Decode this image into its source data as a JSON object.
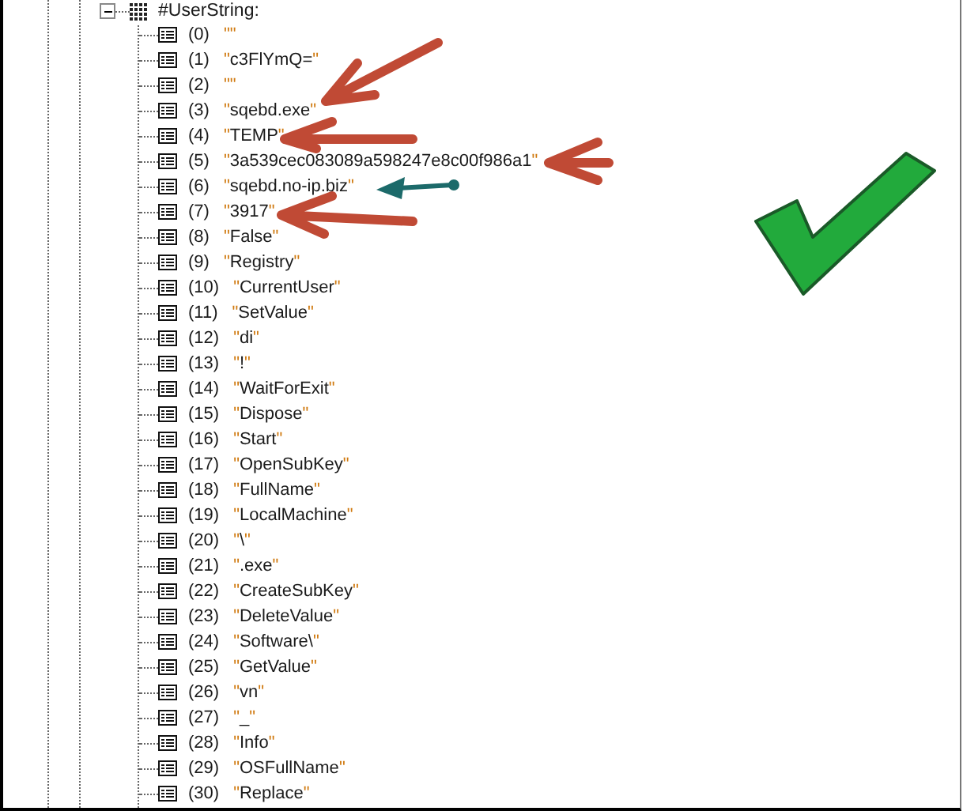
{
  "tree": {
    "label": "#UserString:",
    "expanded": true,
    "children": [
      {
        "index": "(0)",
        "value": "\"\""
      },
      {
        "index": "(1)",
        "value": "\"c3FlYmQ=\""
      },
      {
        "index": "(2)",
        "value": "\"\""
      },
      {
        "index": "(3)",
        "value": "\"sqebd.exe\""
      },
      {
        "index": "(4)",
        "value": "\"TEMP\""
      },
      {
        "index": "(5)",
        "value": "\"3a539cec083089a598247e8c00f986a1\""
      },
      {
        "index": "(6)",
        "value": "\"sqebd.no-ip.biz\""
      },
      {
        "index": "(7)",
        "value": "\"3917\""
      },
      {
        "index": "(8)",
        "value": "\"False\""
      },
      {
        "index": "(9)",
        "value": "\"Registry\""
      },
      {
        "index": "(10)",
        "value": "\"CurrentUser\""
      },
      {
        "index": "(11)",
        "value": "\"SetValue\""
      },
      {
        "index": "(12)",
        "value": "\"di\""
      },
      {
        "index": "(13)",
        "value": "\"!\""
      },
      {
        "index": "(14)",
        "value": "\"WaitForExit\""
      },
      {
        "index": "(15)",
        "value": "\"Dispose\""
      },
      {
        "index": "(16)",
        "value": "\"Start\""
      },
      {
        "index": "(17)",
        "value": "\"OpenSubKey\""
      },
      {
        "index": "(18)",
        "value": "\"FullName\""
      },
      {
        "index": "(19)",
        "value": "\"LocalMachine\""
      },
      {
        "index": "(20)",
        "value": "\"\\\""
      },
      {
        "index": "(21)",
        "value": "\".exe\""
      },
      {
        "index": "(22)",
        "value": "\"CreateSubKey\""
      },
      {
        "index": "(23)",
        "value": "\"DeleteValue\""
      },
      {
        "index": "(24)",
        "value": "\"Software\\\""
      },
      {
        "index": "(25)",
        "value": "\"GetValue\""
      },
      {
        "index": "(26)",
        "value": "\"vn\""
      },
      {
        "index": "(27)",
        "value": "\"_\""
      },
      {
        "index": "(28)",
        "value": "\"Info\""
      },
      {
        "index": "(29)",
        "value": "\"OSFullName\""
      },
      {
        "index": "(30)",
        "value": "\"Replace\""
      }
    ]
  }
}
